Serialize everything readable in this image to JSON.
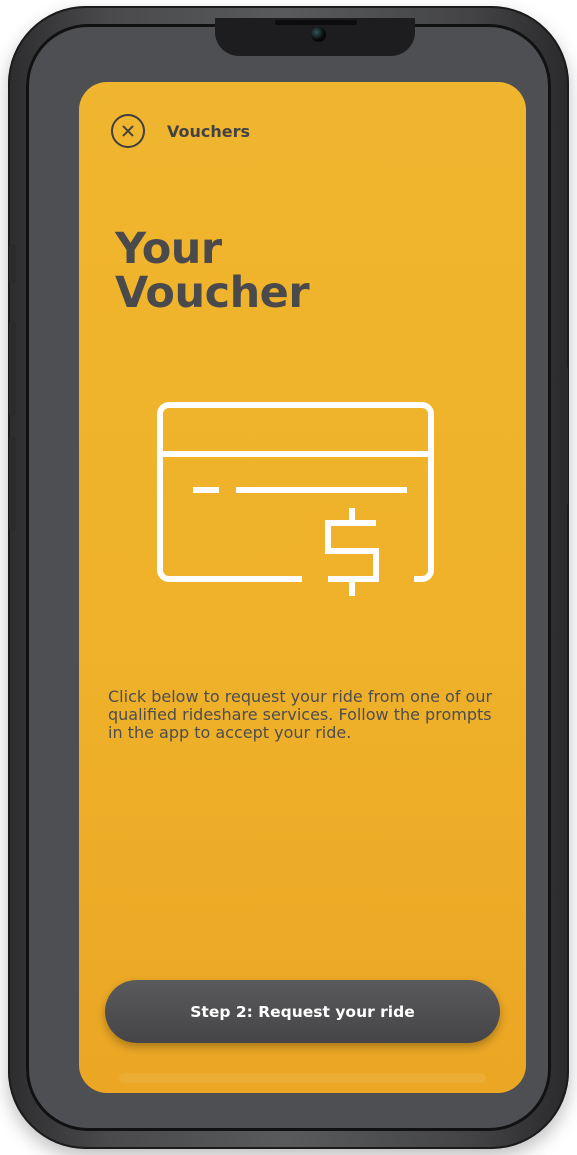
{
  "screen": {
    "header": {
      "title": "Vouchers",
      "close_icon": "close-icon"
    },
    "main": {
      "title_line_1": "Your",
      "title_line_2": "Voucher",
      "illustration_icon": "voucher-card-dollar-icon",
      "description": "Click below to request your ride from one of our qualified rideshare services. Follow the prompts in the app to accept your ride."
    },
    "footer": {
      "cta_label": "Step 2: Request your ride"
    }
  },
  "colors": {
    "screen_background": "#f0b52e",
    "text_primary": "#4a4a4c",
    "button_background": "#4f4f51",
    "button_text": "#ffffff",
    "illustration": "#ffffff"
  }
}
